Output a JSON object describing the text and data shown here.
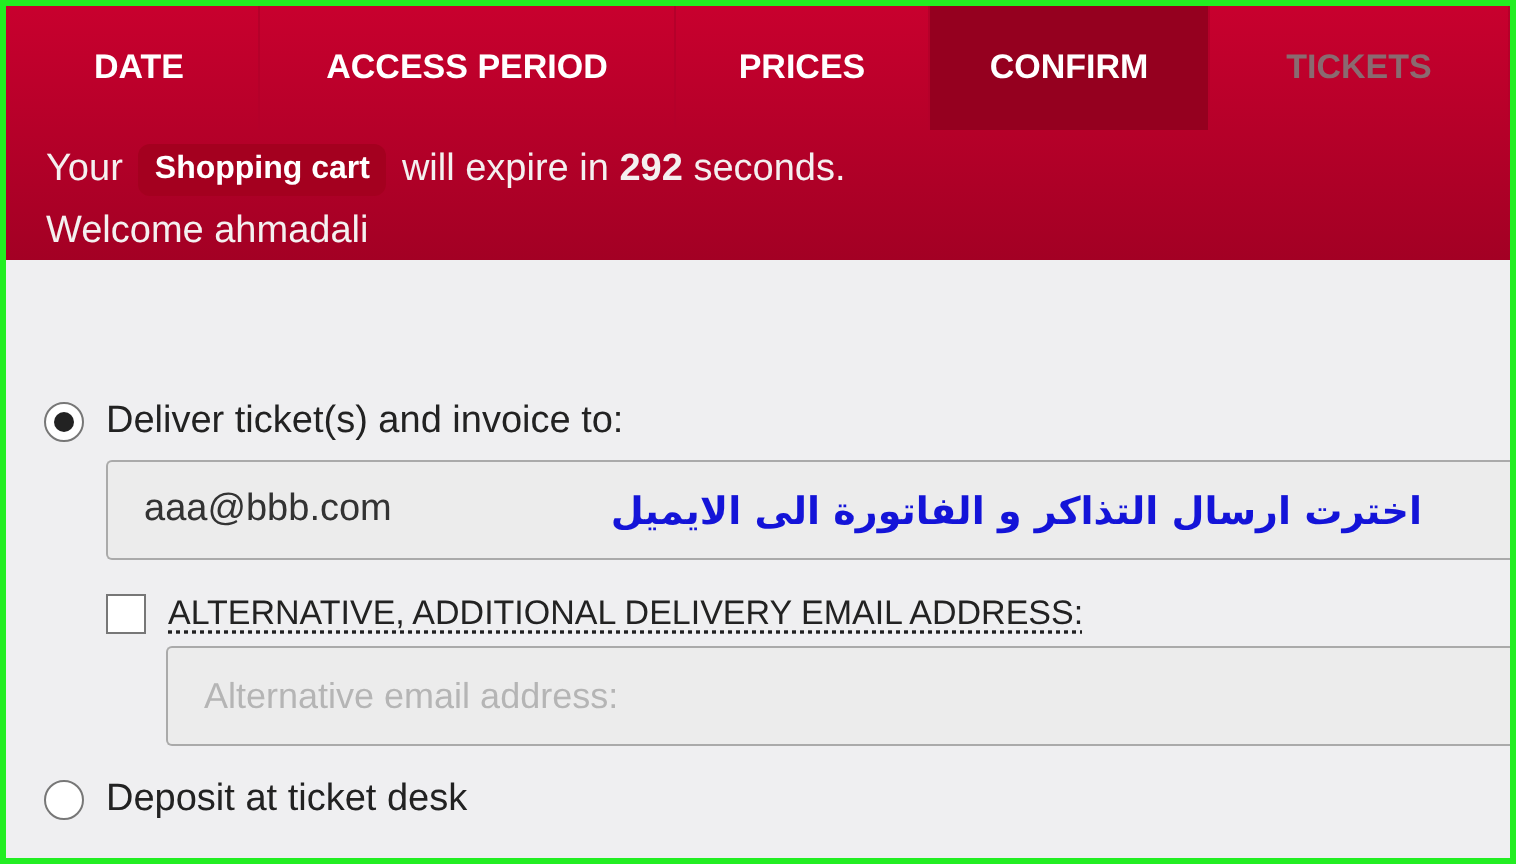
{
  "tabs": [
    {
      "label": "DATE",
      "selected": false,
      "disabled": false
    },
    {
      "label": "ACCESS PERIOD",
      "selected": false,
      "disabled": false
    },
    {
      "label": "PRICES",
      "selected": false,
      "disabled": false
    },
    {
      "label": "CONFIRM",
      "selected": true,
      "disabled": false
    },
    {
      "label": "TICKETS",
      "selected": false,
      "disabled": true
    }
  ],
  "cart": {
    "prefix": "Your",
    "badge": "Shopping cart",
    "suffix": "will expire in **292** seconds."
  },
  "welcome": "Welcome ahmadali",
  "delivery_options": [
    {
      "kind": "email",
      "label": "Deliver ticket(s) and invoice to:",
      "selected": true,
      "email": {
        "value": "aaa@bbb.com"
      },
      "annotation": "اخترت ارسال التذاكر و الفاتورة الى الايميل",
      "alternative": {
        "label": "ALTERNATIVE, ADDITIONAL DELIVERY EMAIL ADDRESS:",
        "checked": false,
        "placeholder": "Alternative email address:"
      }
    },
    {
      "kind": "desk",
      "label": "Deposit at ticket desk",
      "selected": false
    }
  ]
}
